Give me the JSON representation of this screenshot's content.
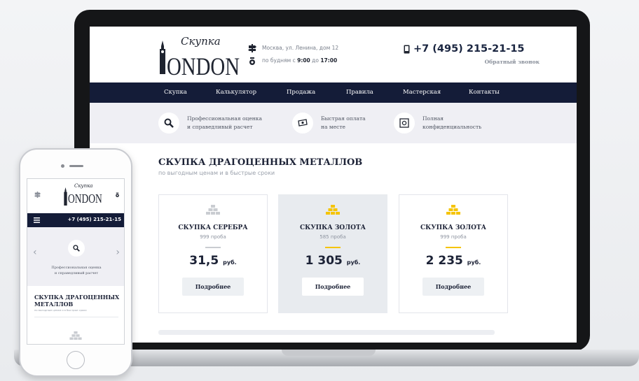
{
  "site": {
    "logo_script": "Скупка",
    "logo_word": "ONDON",
    "address_line": "Москва, ул. Ленина, дом 12",
    "hours_prefix": "по будням с",
    "hours_from": "9:00",
    "hours_mid": "до",
    "hours_to": "17:00",
    "phone": "+7 (495) 215-21-15",
    "callback": "Обратный звонок"
  },
  "nav": [
    "Скупка",
    "Калькулятор",
    "Продажа",
    "Правила",
    "Мастерская",
    "Контакты"
  ],
  "features": [
    {
      "icon": "search-icon",
      "line1": "Профессиональная оценка",
      "line2": "и справедливый расчет"
    },
    {
      "icon": "cash-icon",
      "line1": "Быстрая оплата",
      "line2": "на месте"
    },
    {
      "icon": "safe-icon",
      "line1": "Полная",
      "line2": "конфиденциальность"
    }
  ],
  "section": {
    "title": "СКУПКА ДРАГОЦЕННЫХ МЕТАЛЛОВ",
    "subtitle": "по выгодным ценам и в быстрые сроки"
  },
  "cards": [
    {
      "title": "СКУПКА СЕРЕБРА",
      "probe": "999 проба",
      "price": "31,5",
      "unit": "руб.",
      "button": "Подробнее",
      "accent": "#c9ccd1",
      "active": false
    },
    {
      "title": "СКУПКА ЗОЛОТА",
      "probe": "585 проба",
      "price": "1 305",
      "unit": "руб.",
      "button": "Подробнее",
      "accent": "#f5c400",
      "active": true
    },
    {
      "title": "СКУПКА ЗОЛОТА",
      "probe": "999 проба",
      "price": "2 235",
      "unit": "руб.",
      "button": "Подробнее",
      "accent": "#f5c400",
      "active": false
    }
  ],
  "mobile": {
    "phone": "+7 (495) 215-21-15",
    "feature_line1": "Профессиональная оценка",
    "feature_line2": "и справедливый расчет",
    "title_line1": "СКУПКА ДРАГОЦЕННЫХ",
    "title_line2": "МЕТАЛЛОВ",
    "subtitle": "по выгодным ценам и в быстрые сроки"
  },
  "colors": {
    "navy": "#141c38",
    "gold": "#f5c400",
    "silver": "#c9ccd1",
    "text": "#1c2236"
  }
}
